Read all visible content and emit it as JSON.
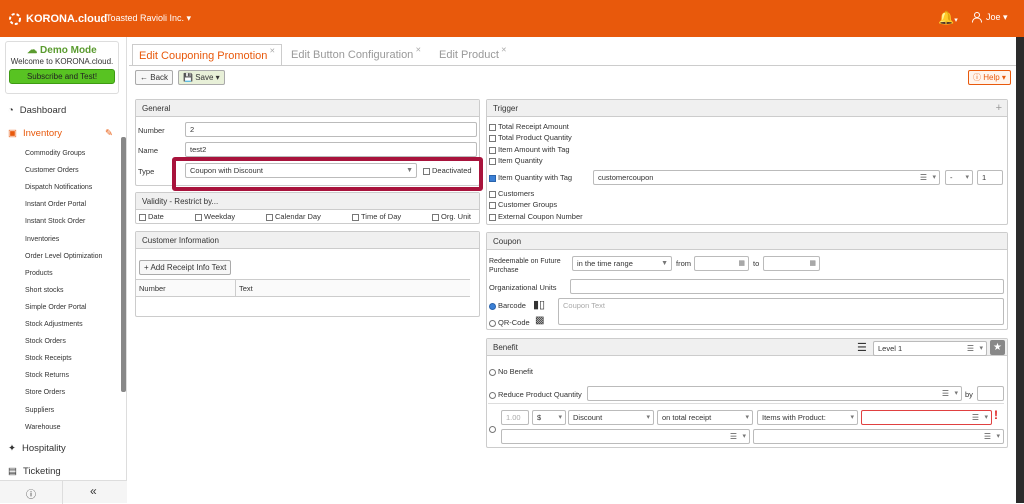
{
  "topbar": {
    "brand": "KORONA.cloud",
    "company": "Toasted Ravioli Inc. ▾",
    "user": "Joe ▾",
    "bell_caret": "▾"
  },
  "sidebar": {
    "demo_title": "Demo Mode",
    "demo_text": "Welcome to KORONA.cloud.",
    "demo_button": "Subscribe and Test!",
    "dashboard": "Dashboard",
    "inventory": "Inventory",
    "inventory_items": [
      "Commodity Groups",
      "Customer Orders",
      "Dispatch Notifications",
      "Instant Order Portal",
      "Instant Stock Order",
      "Inventories",
      "Order Level Optimization",
      "Products",
      "Short stocks",
      "Simple Order Portal",
      "Stock Adjustments",
      "Stock Orders",
      "Stock Receipts",
      "Stock Returns",
      "Store Orders",
      "Suppliers",
      "Warehouse"
    ],
    "hospitality": "Hospitality",
    "ticketing": "Ticketing"
  },
  "tabs": [
    "Edit Couponing Promotion",
    "Edit Button Configuration",
    "Edit Product"
  ],
  "toolbar": {
    "back": "Back",
    "save": "Save",
    "help": "Help"
  },
  "general": {
    "title": "General",
    "number_label": "Number",
    "number_value": "2",
    "name_label": "Name",
    "name_value": "test2",
    "type_label": "Type",
    "type_value": "Coupon with Discount",
    "deactivated": "Deactivated"
  },
  "validity": {
    "title": "Validity - Restrict by...",
    "options": [
      "Date",
      "Weekday",
      "Calendar Day",
      "Time of Day",
      "Org. Unit"
    ]
  },
  "customer": {
    "title": "Customer Information",
    "add_button": "+ Add Receipt Info Text",
    "col_number": "Number",
    "col_text": "Text"
  },
  "trigger": {
    "title": "Trigger",
    "options": [
      "Total Receipt Amount",
      "Total Product Quantity",
      "Item Amount with Tag",
      "Item Quantity",
      "Item Quantity with Tag",
      "Customers",
      "Customer Groups",
      "External Coupon Number"
    ],
    "tag_value": "customercoupon",
    "op_value": "-",
    "qty_value": "1"
  },
  "coupon": {
    "title": "Coupon",
    "redeemable_label": "Redeemable on Future Purchase",
    "range_value": "in the time range",
    "from": "from",
    "to": "to",
    "org_units": "Organizational Units",
    "barcode": "Barcode",
    "qrcode": "QR-Code",
    "coupon_text_placeholder": "Coupon Text"
  },
  "benefit": {
    "title": "Benefit",
    "level": "Level 1",
    "no_benefit": "No Benefit",
    "reduce_qty": "Reduce Product Quantity",
    "by": "by",
    "amount_placeholder": "1.00",
    "currency": "$",
    "discount": "Discount",
    "on_total": "on total receipt",
    "items_with": "Items with Product:",
    "error_mark": "!"
  }
}
